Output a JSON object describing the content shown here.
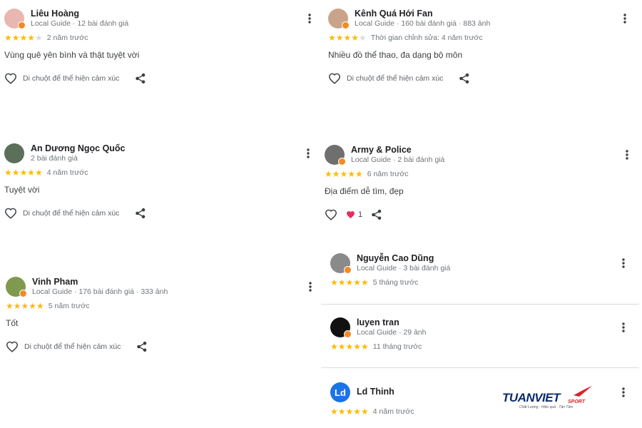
{
  "colors": {
    "star": "#fbbc04",
    "star_off": "#dadce0",
    "badge": "#f28b25",
    "letter_avatar": "#1a73e8",
    "like": "#e52d5c"
  },
  "react_label": "Di chuột để thể hiện cảm xúc",
  "reviews": [
    {
      "name": "Liêu Hoàng",
      "meta": "Local Guide · 12 bài đánh giá",
      "rating": 4,
      "when": "2 năm trước",
      "text": "Vùng quê yên bình và thật tuyệt vời",
      "avatar_color": "#e8b7b0"
    },
    {
      "name": "Kênh Quá Hới Fan",
      "meta": "Local Guide · 160 bài đánh giá · 883 ảnh",
      "rating": 4,
      "when": "Thời gian chỉnh sửa: 4 năm trước",
      "text": "Nhiều đồ thể thao, đa dạng bộ môn",
      "avatar_color": "#c9a38a"
    },
    {
      "name": "An Dương Ngọc Quốc",
      "meta": "2 bài đánh giá",
      "rating": 5,
      "when": "4 năm trước",
      "text": "Tuyệt vời",
      "avatar_color": "#5b6f5a"
    },
    {
      "name": "Army & Police",
      "meta": "Local Guide · 2 bài đánh giá",
      "rating": 5,
      "when": "6 năm trước",
      "text": "Địa điểm dễ tìm, đẹp",
      "avatar_color": "#6f6f6f",
      "like_count": "1"
    },
    {
      "name": "Vinh Pham",
      "meta": "Local Guide · 176 bài đánh giá · 333 ảnh",
      "rating": 5,
      "when": "5 năm trước",
      "text": "Tốt",
      "avatar_color": "#7f9a4e"
    },
    {
      "name": "Nguyễn Cao Dũng",
      "meta": "Local Guide · 3 bài đánh giá",
      "rating": 5,
      "when": "5 tháng trước",
      "avatar_color": "#8a8a8a"
    },
    {
      "name": "luyen tran",
      "meta": "Local Guide · 29 ảnh",
      "rating": 5,
      "when": "11 tháng trước",
      "avatar_color": "#111111"
    },
    {
      "name": "Ld Thinh",
      "avatar_letter": "Ld",
      "rating": 5,
      "when": "4 năm trước"
    }
  ],
  "logo": {
    "brand": "TUANVIET",
    "sport": "SPORT",
    "tagline": "Chất Lượng · Hiệu quả · Tận Tâm"
  }
}
